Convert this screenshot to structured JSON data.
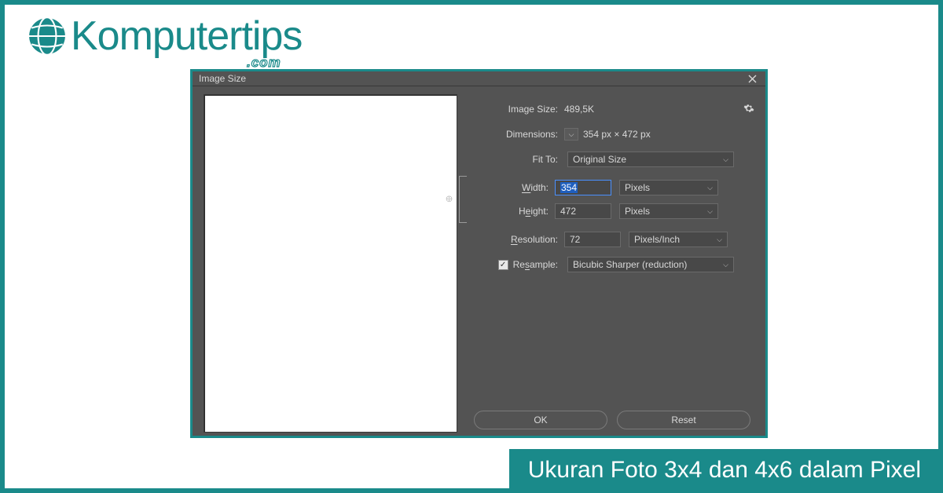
{
  "brand": {
    "name": "Komputertips",
    "suffix": ".com"
  },
  "caption": "Ukuran Foto 3x4 dan 4x6 dalam Pixel",
  "dialog": {
    "title": "Image Size",
    "image_size_label": "Image Size:",
    "image_size_value": "489,5K",
    "dimensions_label": "Dimensions:",
    "dimensions_value": "354 px × 472 px",
    "fit_to_label": "Fit To:",
    "fit_to_value": "Original Size",
    "width_label": "Width:",
    "width_value": "354",
    "width_unit": "Pixels",
    "height_label": "Height:",
    "height_value": "472",
    "height_unit": "Pixels",
    "resolution_label": "Resolution:",
    "resolution_value": "72",
    "resolution_unit": "Pixels/Inch",
    "resample_label": "Resample:",
    "resample_checked": true,
    "resample_value": "Bicubic Sharper (reduction)",
    "ok_label": "OK",
    "reset_label": "Reset"
  },
  "colors": {
    "brand": "#1a8a8a",
    "dialog_bg": "#535353",
    "field_bg": "#484848"
  }
}
